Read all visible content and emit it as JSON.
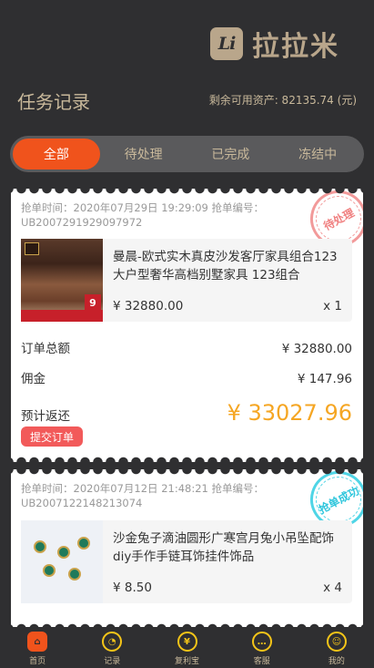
{
  "logo": {
    "badge": "Li",
    "name": "拉拉米"
  },
  "page_title": "任务记录",
  "balance": "剩余可用资产: 82135.74 (元)",
  "tabs": [
    {
      "label": "全部",
      "active": true
    },
    {
      "label": "待处理",
      "active": false
    },
    {
      "label": "已完成",
      "active": false
    },
    {
      "label": "冻结中",
      "active": false
    }
  ],
  "orders": [
    {
      "meta": "抢单时间：2020年07月29日 19:29:09 抢单编号：UB2007291929097972",
      "stamp": "待处理",
      "product_name": "曼晨-欧式实木真皮沙发客厅家具组合123大户型奢华高档别墅家具 123组合",
      "price": "¥ 32880.00",
      "qty": "x 1",
      "image_icon": "sofa-product-image",
      "total_label": "订单总额",
      "total_value": "¥ 32880.00",
      "commission_label": "佣金",
      "commission_value": "¥ 147.96",
      "refund_label": "预计返还",
      "refund_value": "¥ 33027.96",
      "submit_label": "提交订单"
    },
    {
      "meta": "抢单时间：2020年07月12日 21:48:21 抢单编号：UB2007122148213074",
      "stamp": "抢单成功",
      "product_name": "沙金兔子滴油圆形广寒宫月兔小吊坠配饰diy手作手链耳饰挂件饰品",
      "price": "¥ 8.50",
      "qty": "x 4",
      "image_icon": "jewelry-product-image"
    }
  ],
  "nav": [
    {
      "label": "首页",
      "icon": "home-icon"
    },
    {
      "label": "记录",
      "icon": "record-icon"
    },
    {
      "label": "复利宝",
      "icon": "money-bag-icon"
    },
    {
      "label": "客服",
      "icon": "chat-icon"
    },
    {
      "label": "我的",
      "icon": "profile-icon"
    }
  ],
  "colors": {
    "accent": "#f0531c",
    "gold": "#c9b99b",
    "refund": "#f5a623",
    "submit": "#f25a5a"
  }
}
